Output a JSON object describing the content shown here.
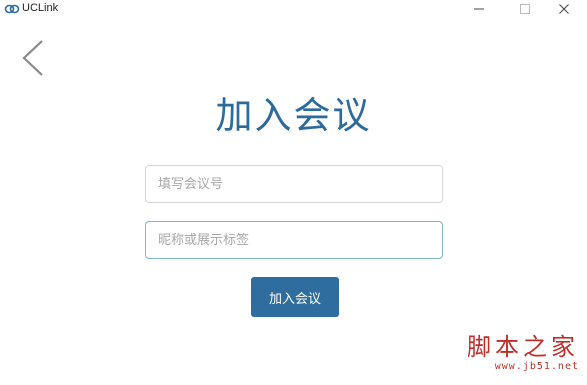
{
  "window": {
    "title": "UCLink",
    "logo_icon": "link-rings-icon",
    "controls": {
      "minimize_icon": "minimize-icon",
      "maximize_icon": "maximize-icon",
      "close_icon": "close-icon"
    }
  },
  "nav": {
    "back_icon": "chevron-left-icon"
  },
  "main": {
    "title": "加入会议",
    "meeting_id_field": {
      "value": "",
      "placeholder": "填写会议号"
    },
    "nickname_field": {
      "value": "",
      "placeholder": "昵称或展示标签"
    },
    "join_button_label": "加入会议"
  },
  "watermark": {
    "main": "脚本之家",
    "url": "www.jb51.net"
  },
  "colors": {
    "accent": "#2f6d9e",
    "title": "#2c6b9c",
    "focus_border": "#7fb6c9",
    "watermark": "#c0302b"
  }
}
